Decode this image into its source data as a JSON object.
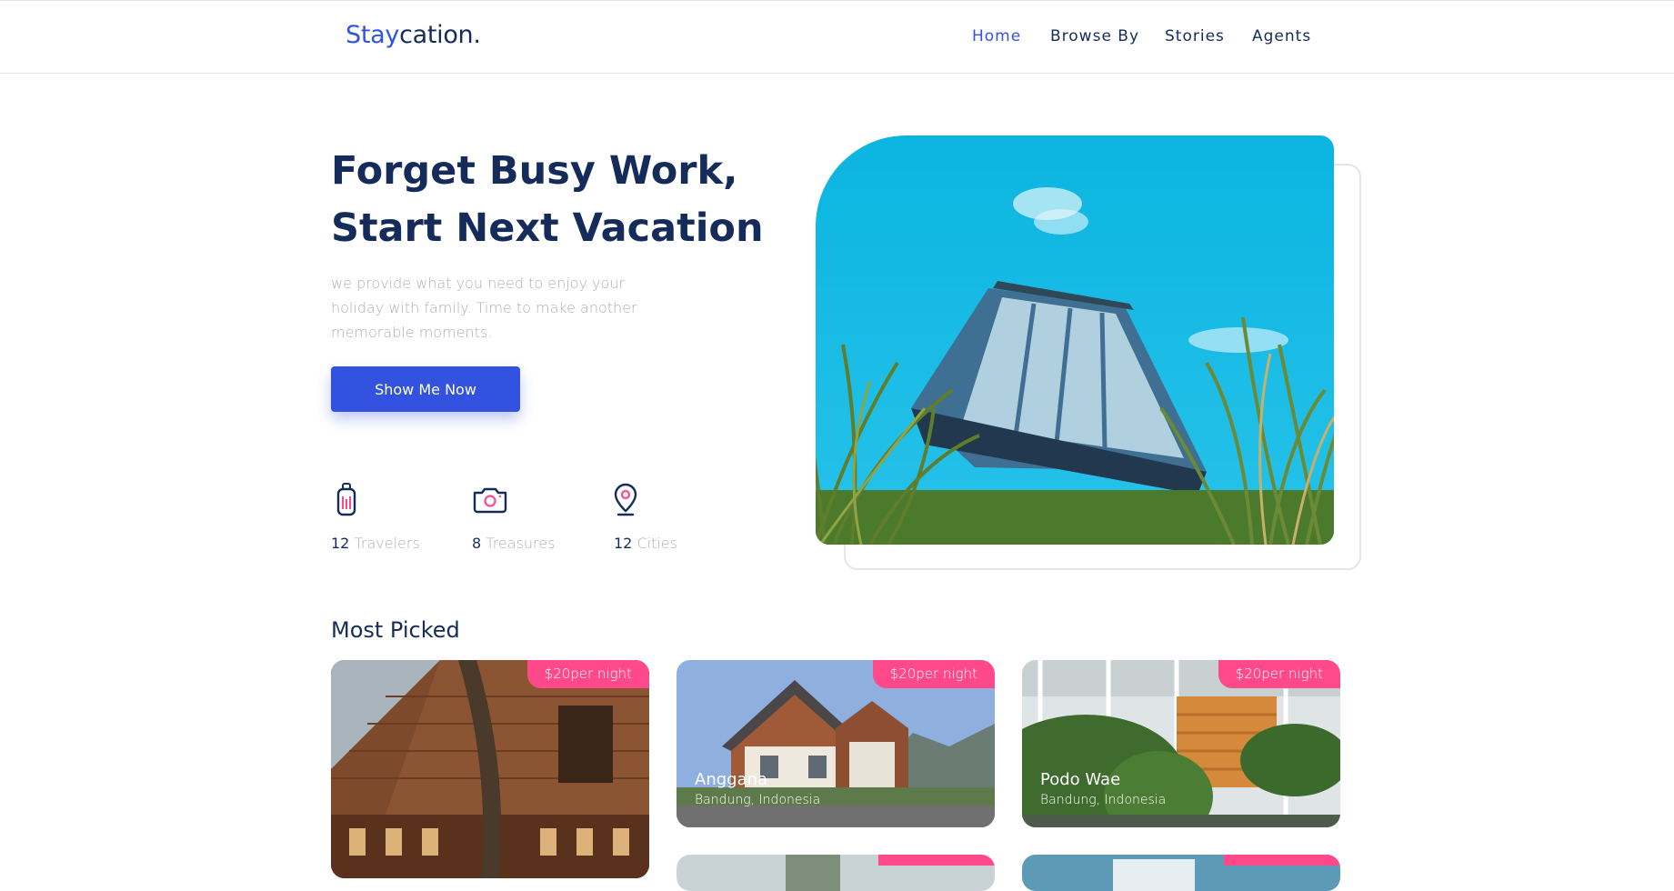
{
  "header": {
    "brand_part1": "Stay",
    "brand_part2": "cation.",
    "nav": [
      "Home",
      "Browse By",
      "Stories",
      "Agents"
    ]
  },
  "hero": {
    "title_line1": "Forget Busy Work,",
    "title_line2": "Start Next Vacation",
    "subtitle": "we provide what you need to enjoy your holiday with family. Time to make another memorable moments.",
    "cta_label": "Show Me Now",
    "stats": [
      {
        "number": "12",
        "label": "Travelers",
        "icon": "luggage-icon"
      },
      {
        "number": "8",
        "label": "Treasures",
        "icon": "camera-icon"
      },
      {
        "number": "12",
        "label": "Cities",
        "icon": "map-pin-icon"
      }
    ]
  },
  "most_picked": {
    "title": "Most Picked",
    "items": [
      {
        "price": "$20per night",
        "name": "",
        "location": ""
      },
      {
        "price": "$20per night",
        "name": "Anggana",
        "location": "Bandung, Indonesia"
      },
      {
        "price": "$20per night",
        "name": "Podo Wae",
        "location": "Bandung, Indonesia"
      }
    ]
  },
  "colors": {
    "primary": "#3252DF",
    "navy": "#152C5B",
    "muted": "#B0B0B0",
    "accent": "#FF498B"
  }
}
